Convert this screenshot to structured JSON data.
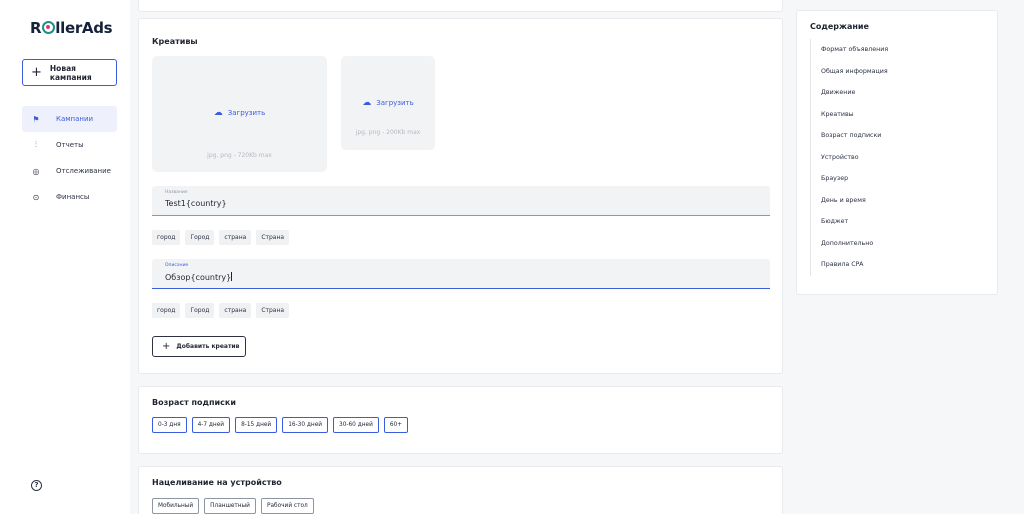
{
  "sidebar": {
    "logo": {
      "before": "R",
      "after": "llerAds"
    },
    "new_campaign": "Новая кампания",
    "items": [
      {
        "label": "Кампании",
        "icon": "flag-icon",
        "glyph": "⚑",
        "active": true
      },
      {
        "label": "Отчеты",
        "icon": "chart-icon",
        "glyph": "⫶",
        "active": false
      },
      {
        "label": "Отслеживание",
        "icon": "target-icon",
        "glyph": "◎",
        "active": false
      },
      {
        "label": "Финансы",
        "icon": "coin-icon",
        "glyph": "⊙",
        "active": false
      }
    ],
    "help_glyph": "?"
  },
  "creatives": {
    "title": "Креативы",
    "uploads": [
      {
        "button": "Загрузить",
        "hint": "jpg, png - 720Kb max"
      },
      {
        "button": "Загрузить",
        "hint": "jpg, png - 200Kb max"
      }
    ],
    "name_field": {
      "label": "Название",
      "value": "Test1{country}"
    },
    "name_chips": [
      "город",
      "Город",
      "страна",
      "Страна"
    ],
    "description_field": {
      "label": "Описание",
      "value": "Обзор{country}"
    },
    "description_chips": [
      "город",
      "Город",
      "страна",
      "Страна"
    ],
    "add_button": "Добавить креатив"
  },
  "subscription_age": {
    "title": "Возраст подписки",
    "options": [
      "0-3 дня",
      "4-7 дней",
      "8-15 дней",
      "16-30 дней",
      "30-60 дней",
      "60+"
    ]
  },
  "device_targeting": {
    "title": "Нацеливание на устройство",
    "options": [
      "Мобильный",
      "Планшетный",
      "Рабочий стол"
    ]
  },
  "toc": {
    "title": "Содержание",
    "items": [
      "Формат объявления",
      "Общая информация",
      "Движение",
      "Креативы",
      "Возраст подписки",
      "Устройство",
      "Браузер",
      "День и время",
      "Бюджет",
      "Дополнительно",
      "Правила CPA"
    ]
  },
  "colors": {
    "accent": "#3b5cdf",
    "logo_teal": "#1c8f8a",
    "logo_pink": "#e23b6b"
  }
}
